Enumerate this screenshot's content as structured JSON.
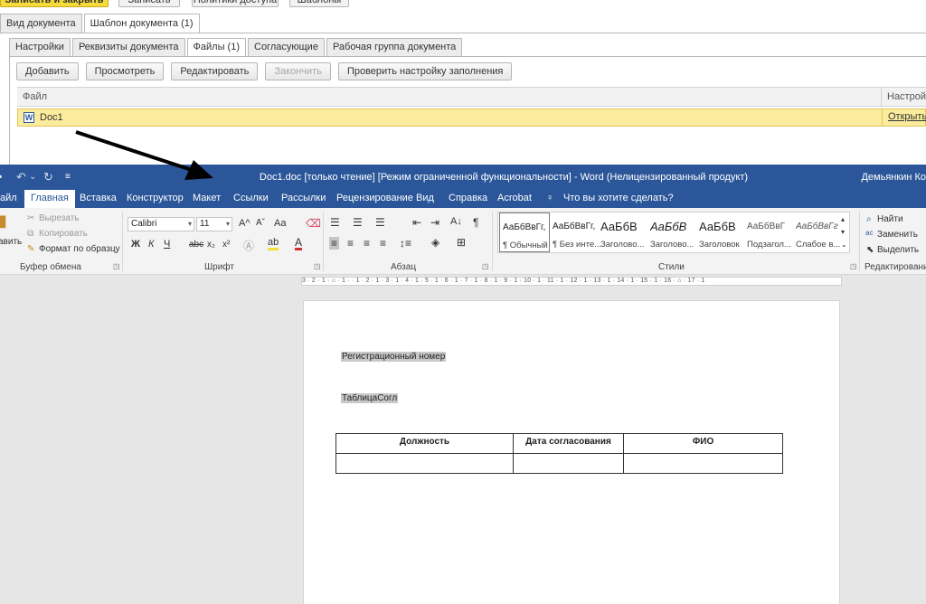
{
  "onec": {
    "top_buttons": {
      "save_close": "Записать и закрыть",
      "save": "Записать",
      "access_policy": "Политики доступа",
      "templates": "Шаблоны"
    },
    "main_tabs": [
      {
        "label": "Вид документа"
      },
      {
        "label": "Шаблон документа (1)"
      }
    ],
    "sub_tabs": [
      {
        "label": "Настройки"
      },
      {
        "label": "Реквизиты документа"
      },
      {
        "label": "Файлы (1)"
      },
      {
        "label": "Согласующие"
      },
      {
        "label": "Рабочая группа документа"
      }
    ],
    "toolbar": {
      "add": "Добавить",
      "view": "Просмотреть",
      "edit": "Редактировать",
      "finish": "Закончить",
      "check": "Проверить настройку заполнения"
    },
    "grid": {
      "col_file": "Файл",
      "col_setting": "Настройка",
      "rows": [
        {
          "icon": "W",
          "name": "Doc1",
          "action": "Открыть"
        }
      ]
    }
  },
  "word": {
    "title": "Doc1.doc [только чтение] [Режим ограниченной функциональности]  -  Word (Нелицензированный продукт)",
    "user": "Демьянкин Ко",
    "menu": {
      "file": "айл",
      "home": "Главная",
      "insert": "Вставка",
      "design": "Конструктор",
      "layout": "Макет",
      "refs": "Ссылки",
      "mailings": "Рассылки",
      "review": "Рецензирование",
      "view": "Вид",
      "help": "Справка",
      "acrobat": "Acrobat",
      "tell_me": "Что вы хотите сделать?"
    },
    "clipboard": {
      "paste": "авить",
      "cut": "Вырезать",
      "copy": "Копировать",
      "format_painter": "Формат по образцу",
      "label": "Буфер обмена"
    },
    "font": {
      "name": "Calibri",
      "size": "11",
      "label": "Шрифт",
      "bold": "Ж",
      "italic": "К",
      "underline": "Ч",
      "strike": "abc",
      "sub": "x₂",
      "sup": "x²",
      "case": "Aa",
      "grow": "A^",
      "shrink": "Aˇ"
    },
    "paragraph": {
      "label": "Абзац",
      "pilcrow": "¶"
    },
    "styles": {
      "label": "Стили",
      "items": [
        {
          "sample": "АаБбВвГг,",
          "name": "¶ Обычный"
        },
        {
          "sample": "АаБбВвГг,",
          "name": "¶ Без инте..."
        },
        {
          "sample": "АаБбВ",
          "name": "Заголово..."
        },
        {
          "sample": "АаБбВ",
          "name": "Заголово..."
        },
        {
          "sample": "АаБбВ",
          "name": "Заголовок"
        },
        {
          "sample": "АаБбВвГ",
          "name": "Подзагол..."
        },
        {
          "sample": "АаБбВвГг",
          "name": "Слабое в..."
        }
      ]
    },
    "editing": {
      "find": "Найти",
      "replace": "Заменить",
      "select": "Выделить",
      "label": "Редактирование"
    },
    "ruler": "3 · 2 · 1 · ⌂ · 1 · · 1 · 2 · 1 · 3 · 1 · 4 · 1 · 5 · 1 · 6 · 1 · 7 · 1 · 8 · 1 · 9 · 1 · 10 · 1 · 11 · 1 · 12 · 1 · 13 · 1 · 14 · 1 · 15 · 1 · 16 · ⌂ · 17 · 1",
    "document": {
      "field_reg": "Регистрационный номер",
      "field_table": "ТаблицаСогл",
      "table_headers": [
        "Должность",
        "Дата согласования",
        "ФИО"
      ]
    }
  }
}
